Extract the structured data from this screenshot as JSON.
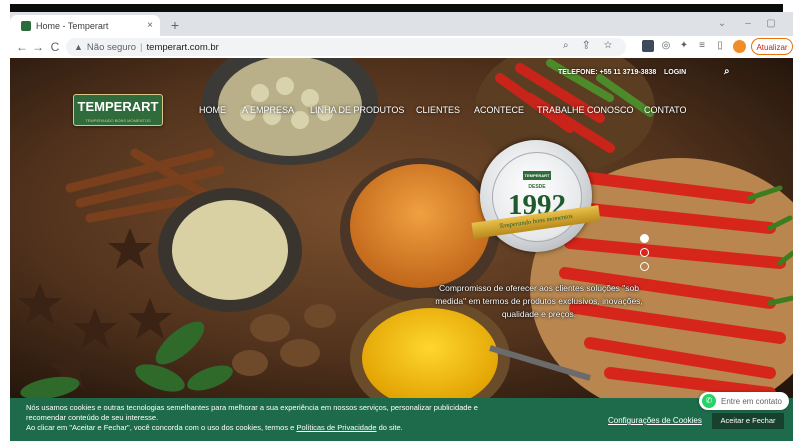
{
  "browser": {
    "tab_title": "Home - Temperart",
    "tab_close": "×",
    "new_tab": "+",
    "window_controls": [
      "⌄",
      "–",
      "▢"
    ],
    "back": "←",
    "forward": "→",
    "reload": "C",
    "security_icon": "▲",
    "security_label": "Não seguro",
    "separator": "|",
    "url": "temperart.com.br",
    "omnibox_icons": "⌕ ⇪ ☆",
    "update_label": "Atualizar",
    "profile_initial": ""
  },
  "site": {
    "logo_text": "TEMPERART",
    "logo_sub": "TEMPERANDO BONS MOMENTOS",
    "phone": "TELEFONE: +55 11 3719-3838",
    "login": "LOGIN",
    "search_icon": "⌕",
    "nav": [
      "HOME",
      "A EMPRESA",
      "LINHA DE PRODUTOS",
      "CLIENTES",
      "ACONTECE",
      "TRABALHE CONOSCO",
      "CONTATO"
    ],
    "seal": {
      "logo": "TEMPERART",
      "desde": "DESDE",
      "year": "1992",
      "ribbon": "Temperando bons momentos"
    },
    "slider_active": 0,
    "tagline": "Compromisso de oferecer aos clientes soluções \"sob medida\" em termos de produtos exclusivos, inovações, qualidade e preços."
  },
  "cookie": {
    "line1": "Nós usamos cookies e outras tecnologias semelhantes para melhorar a sua experiência em nossos serviços, personalizar publicidade e",
    "line2": "recomendar conteúdo de seu interesse.",
    "line3_a": "Ao clicar em \"Aceitar e Fechar\", você concorda com o uso dos cookies, termos e ",
    "privacy_link": "Políticas de Privacidade",
    "line3_b": " do site.",
    "settings_link": "Configurações de Cookies",
    "accept": "Aceitar e Fechar"
  },
  "whatsapp": {
    "label": "Entre em contato"
  },
  "colors": {
    "brand_green": "#2f6b3b",
    "cookie_bg": "#1e6b4c",
    "accept_bg": "#17402f",
    "whatsapp": "#25d366",
    "update_border": "#e8710a"
  }
}
